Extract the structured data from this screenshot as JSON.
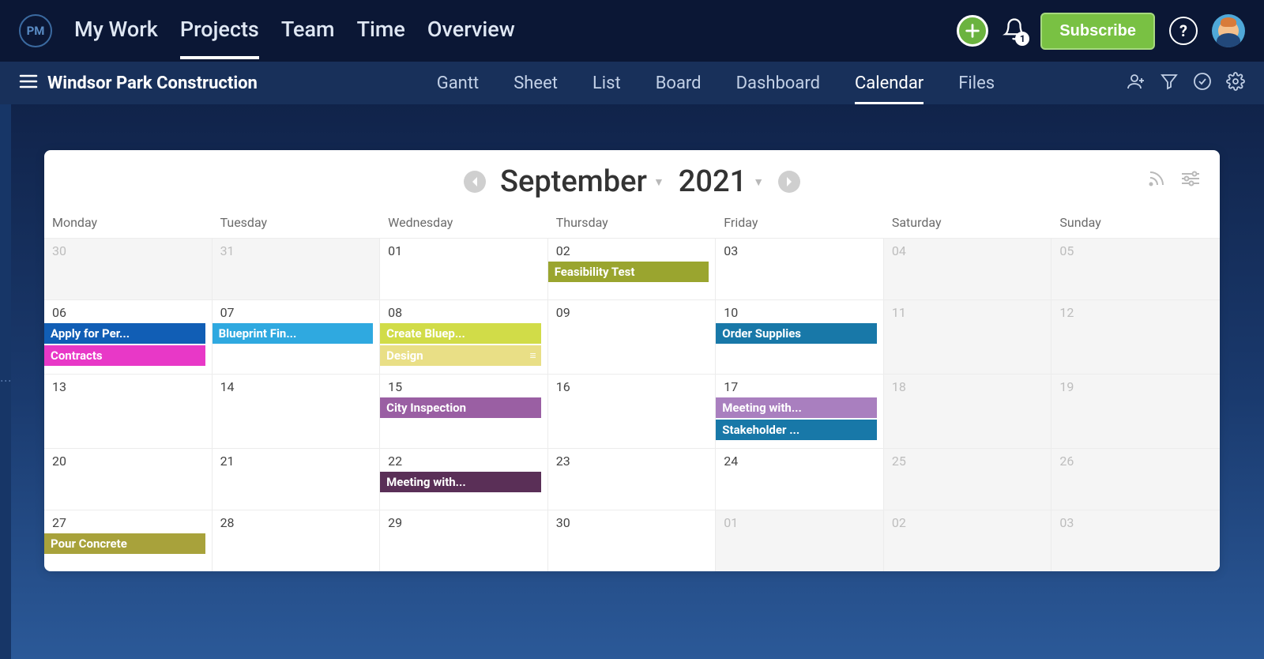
{
  "logo": "PM",
  "topnav": {
    "tabs": [
      "My Work",
      "Projects",
      "Team",
      "Time",
      "Overview"
    ],
    "active": 1
  },
  "subscribe_label": "Subscribe",
  "notification_count": "1",
  "subnav": {
    "project_title": "Windsor Park Construction",
    "tabs": [
      "Gantt",
      "Sheet",
      "List",
      "Board",
      "Dashboard",
      "Calendar",
      "Files"
    ],
    "active": 5
  },
  "calendar": {
    "month": "September",
    "year": "2021",
    "weekdays": [
      "Monday",
      "Tuesday",
      "Wednesday",
      "Thursday",
      "Friday",
      "Saturday",
      "Sunday"
    ],
    "weeks": [
      [
        {
          "day": "30",
          "outside": true,
          "events": []
        },
        {
          "day": "31",
          "outside": true,
          "events": []
        },
        {
          "day": "01",
          "outside": false,
          "events": []
        },
        {
          "day": "02",
          "outside": false,
          "events": [
            {
              "label": "Feasibility Test",
              "color": "#9aa52f"
            }
          ]
        },
        {
          "day": "03",
          "outside": false,
          "events": []
        },
        {
          "day": "04",
          "outside": true,
          "events": []
        },
        {
          "day": "05",
          "outside": true,
          "events": []
        }
      ],
      [
        {
          "day": "06",
          "outside": false,
          "events": [
            {
              "label": "Apply for Per...",
              "color": "#115eb5"
            },
            {
              "label": "Contracts",
              "color": "#e838c7"
            }
          ]
        },
        {
          "day": "07",
          "outside": false,
          "events": [
            {
              "label": "Blueprint Fin...",
              "color": "#2fa9e0"
            }
          ]
        },
        {
          "day": "08",
          "outside": false,
          "events": [
            {
              "label": "Create Bluep...",
              "color": "#d1dc48"
            },
            {
              "label": "Design",
              "color": "#e9df86",
              "menu": true
            }
          ]
        },
        {
          "day": "09",
          "outside": false,
          "events": []
        },
        {
          "day": "10",
          "outside": false,
          "events": [
            {
              "label": "Order Supplies",
              "color": "#1878a8"
            }
          ]
        },
        {
          "day": "11",
          "outside": true,
          "events": []
        },
        {
          "day": "12",
          "outside": true,
          "events": []
        }
      ],
      [
        {
          "day": "13",
          "outside": false,
          "events": []
        },
        {
          "day": "14",
          "outside": false,
          "events": []
        },
        {
          "day": "15",
          "outside": false,
          "events": [
            {
              "label": "City Inspection",
              "color": "#9a5fa3"
            }
          ]
        },
        {
          "day": "16",
          "outside": false,
          "events": []
        },
        {
          "day": "17",
          "outside": false,
          "events": [
            {
              "label": "Meeting with...",
              "color": "#a97fbf"
            },
            {
              "label": "Stakeholder ...",
              "color": "#1878a8"
            }
          ]
        },
        {
          "day": "18",
          "outside": true,
          "events": []
        },
        {
          "day": "19",
          "outside": true,
          "events": []
        }
      ],
      [
        {
          "day": "20",
          "outside": false,
          "events": []
        },
        {
          "day": "21",
          "outside": false,
          "events": []
        },
        {
          "day": "22",
          "outside": false,
          "events": [
            {
              "label": "Meeting with...",
              "color": "#5a2f57"
            }
          ]
        },
        {
          "day": "23",
          "outside": false,
          "events": []
        },
        {
          "day": "24",
          "outside": false,
          "events": []
        },
        {
          "day": "25",
          "outside": true,
          "events": []
        },
        {
          "day": "26",
          "outside": true,
          "events": []
        }
      ],
      [
        {
          "day": "27",
          "outside": false,
          "events": [
            {
              "label": "Pour Concrete",
              "color": "#a8a23b"
            }
          ]
        },
        {
          "day": "28",
          "outside": false,
          "events": []
        },
        {
          "day": "29",
          "outside": false,
          "events": []
        },
        {
          "day": "30",
          "outside": false,
          "events": []
        },
        {
          "day": "01",
          "outside": true,
          "events": []
        },
        {
          "day": "02",
          "outside": true,
          "events": []
        },
        {
          "day": "03",
          "outside": true,
          "events": []
        }
      ]
    ]
  }
}
